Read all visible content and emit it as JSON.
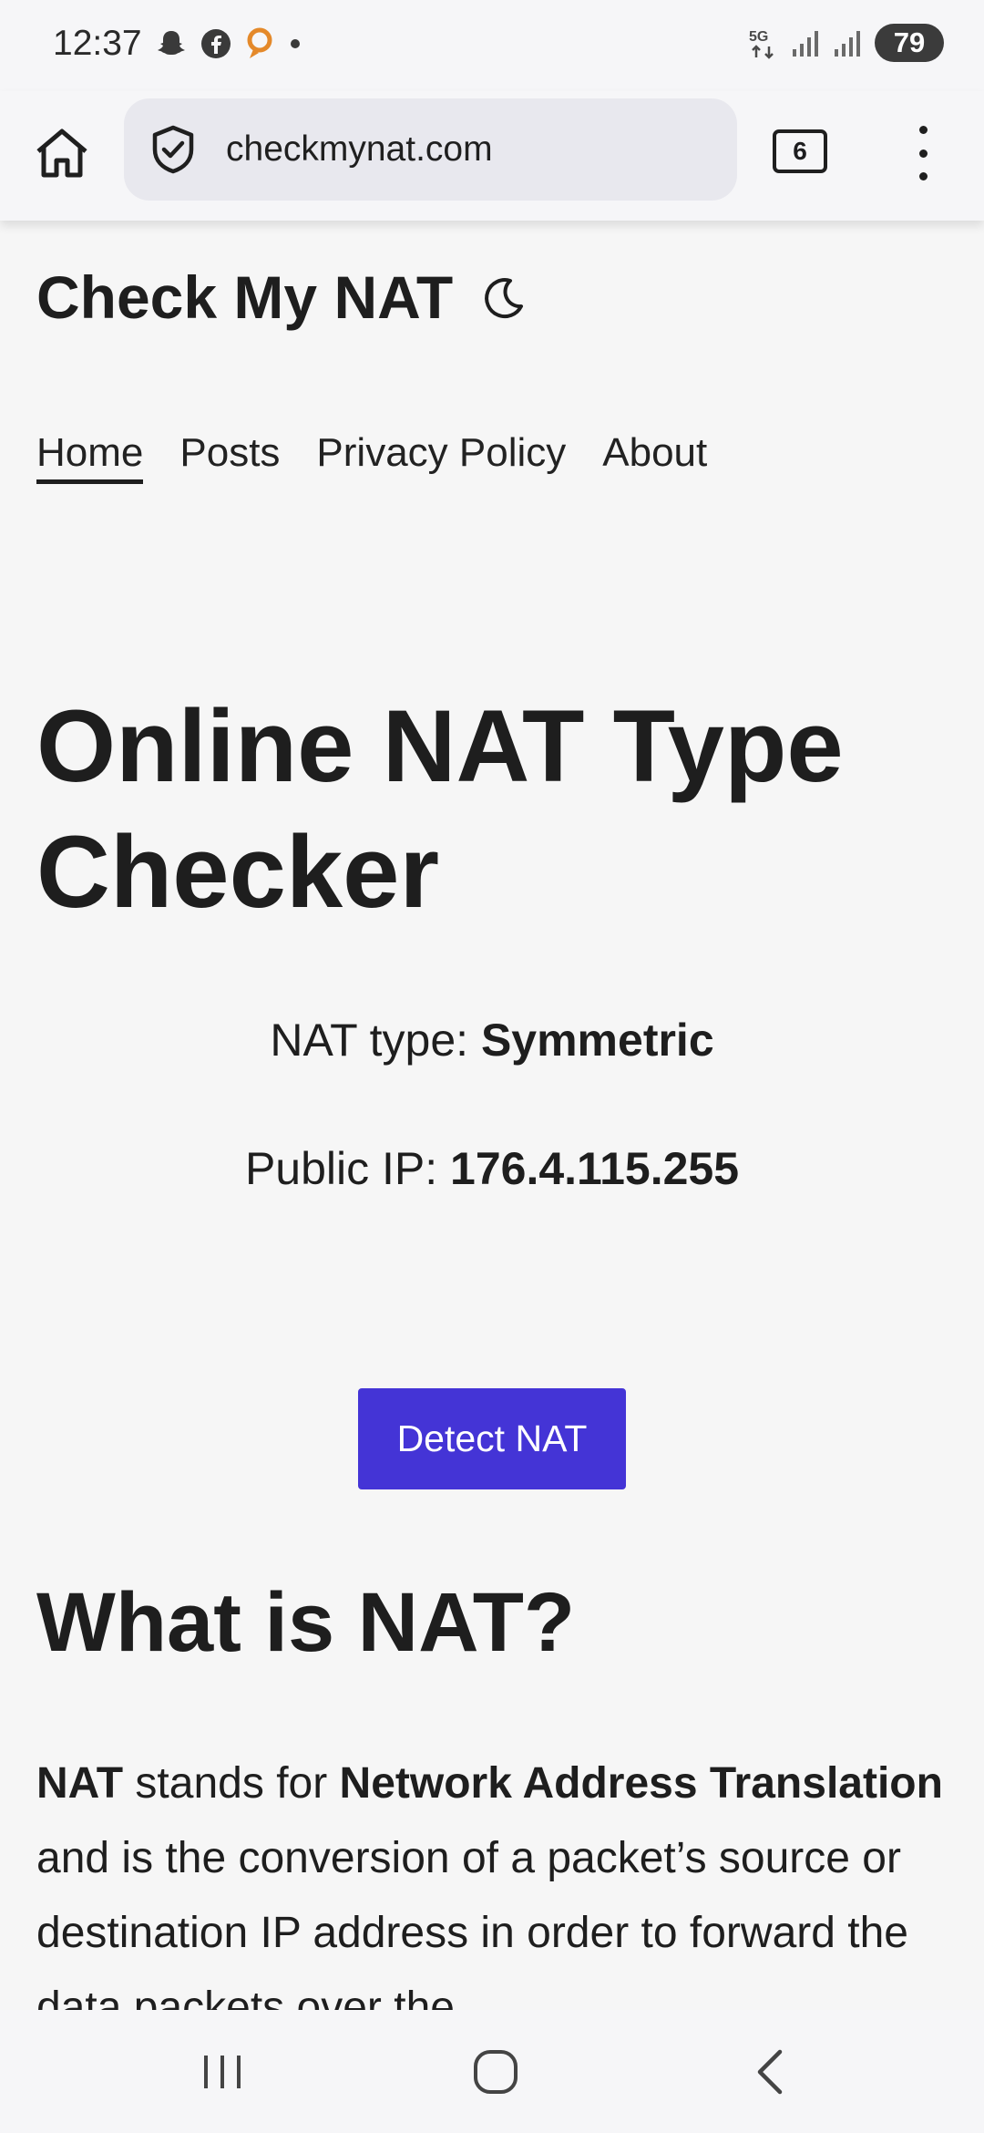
{
  "status_bar": {
    "time": "12:37",
    "battery": "79",
    "network": "5G",
    "icons": [
      "snapchat-icon",
      "facebook-icon",
      "app-icon",
      "dot-icon",
      "5g-icon",
      "signal-icon",
      "signal-icon"
    ]
  },
  "browser": {
    "url": "checkmynat.com",
    "tab_count": "6"
  },
  "site": {
    "title": "Check My NAT",
    "nav": [
      "Home",
      "Posts",
      "Privacy Policy",
      "About"
    ],
    "active_nav": "Home"
  },
  "main": {
    "heading": "Online NAT Type Checker",
    "nat_type_label": "NAT type: ",
    "nat_type_value": "Symmetric",
    "public_ip_label": "Public IP: ",
    "public_ip_value": "176.4.115.255",
    "detect_button": "Detect NAT",
    "section_heading": "What is NAT?",
    "para": {
      "t1": "NAT",
      "t2": " stands for ",
      "t3": "Network Address Translation",
      "t4": " and is the conversion of a packet’s source or destination IP address in order to forward the data packets over the"
    }
  },
  "colors": {
    "accent": "#4434d6",
    "background": "#f6f6f6"
  }
}
